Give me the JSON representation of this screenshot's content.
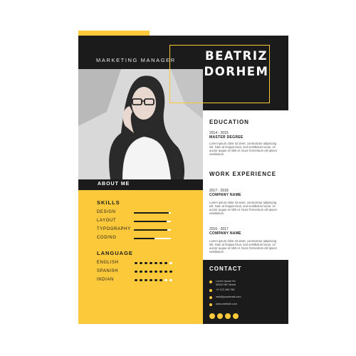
{
  "header": {
    "job_title": "MARKETING MANAGER",
    "name_line1": "BEATRIZ",
    "name_line2": "DORHEM"
  },
  "about": {
    "label": "ABOUT ME"
  },
  "skills": {
    "heading": "SKILLS",
    "items": [
      {
        "label": "DESIGN",
        "level": 0.95
      },
      {
        "label": "LAYOUT",
        "level": 0.88
      },
      {
        "label": "TYPOGRAPHY",
        "level": 0.9
      },
      {
        "label": "CODING",
        "level": 0.55
      }
    ]
  },
  "language": {
    "heading": "LANGUAGE",
    "items": [
      {
        "label": "ENGLISH",
        "filled": 7,
        "total": 8
      },
      {
        "label": "SPANISH",
        "filled": 8,
        "total": 8
      },
      {
        "label": "INDIAN",
        "filled": 6,
        "total": 8
      }
    ]
  },
  "education": {
    "heading": "EDUCATION",
    "date": "2014 - 2015",
    "degree": "MASTER DEGREE",
    "text": "Lorem ipsum dolor sit amet, consectetur adipiscing elit. Nam at feugiat risus, sed vestibulum lacus. Ut auctor augue et nibh et. Nunc fermentum elit ipsum vestibulum."
  },
  "experience": {
    "heading": "WORK EXPERIENCE",
    "jobs": [
      {
        "date": "2017 - 2018",
        "company": "COMPANY NAME",
        "text": "Lorem ipsum dolor sit amet, consectetur adipiscing elit. Nam at feugiat risus, sed vestibulum lacus. Ut auctor augue et nibh et. Nunc fermentum elit ipsum vestibulum."
      },
      {
        "date": "2016 - 2017",
        "company": "COMPANY NAME",
        "text": "Lorem ipsum dolor sit amet, consectetur adipiscing elit. Nam at feugiat risus, sed vestibulum lacus. Ut auctor augue et nibh et. Nunc fermentum elit ipsum vestibulum."
      }
    ]
  },
  "contact": {
    "heading": "CONTACT",
    "address_line1": "Lorem Ipsum 00",
    "address_line2": "00000 NE Street",
    "phone": "+0 123 456 789",
    "email": "mail@youremail.com",
    "website": "www.website.com"
  },
  "colors": {
    "accent": "#fcc93a",
    "dark": "#1b1b1b"
  }
}
